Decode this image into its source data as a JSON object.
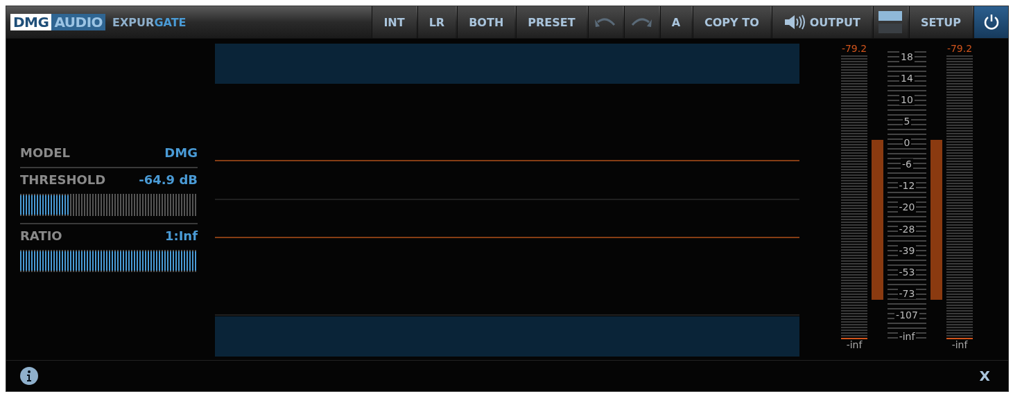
{
  "header": {
    "logo": [
      "DMG",
      "AUDIO"
    ],
    "product": [
      "EXPUR",
      "GATE"
    ]
  },
  "toolbar": [
    {
      "kind": "text",
      "label": "INT"
    },
    {
      "kind": "text",
      "label": "LR"
    },
    {
      "kind": "text",
      "label": "BOTH"
    },
    {
      "kind": "text",
      "label": "PRESET"
    },
    {
      "kind": "undo"
    },
    {
      "kind": "redo"
    },
    {
      "kind": "text",
      "label": "A"
    },
    {
      "kind": "text",
      "label": "COPY TO"
    },
    {
      "kind": "output",
      "label": "OUTPUT"
    },
    {
      "kind": "layout"
    },
    {
      "kind": "text",
      "label": "SETUP"
    },
    {
      "kind": "power",
      "on": true
    }
  ],
  "params": [
    {
      "kind": "choice",
      "label": "MODEL",
      "value": "DMG"
    },
    {
      "kind": "slider",
      "label": "THRESHOLD",
      "value": "-64.9 dB",
      "level": 0.28
    },
    {
      "kind": "slider",
      "label": "RATIO",
      "value": "1:Inf",
      "level": 1
    }
  ],
  "meters": [
    {
      "peak": "-79.2",
      "floor": "-inf",
      "level": 0
    },
    {
      "peak": "-79.2",
      "floor": "-inf",
      "level": 0
    }
  ],
  "scale": [
    "18",
    "14",
    "10",
    "5",
    "0",
    "-6",
    "-12",
    "-20",
    "-28",
    "-39",
    "-53",
    "-73",
    "-107",
    "-inf"
  ],
  "footer": {
    "close": "X"
  }
}
